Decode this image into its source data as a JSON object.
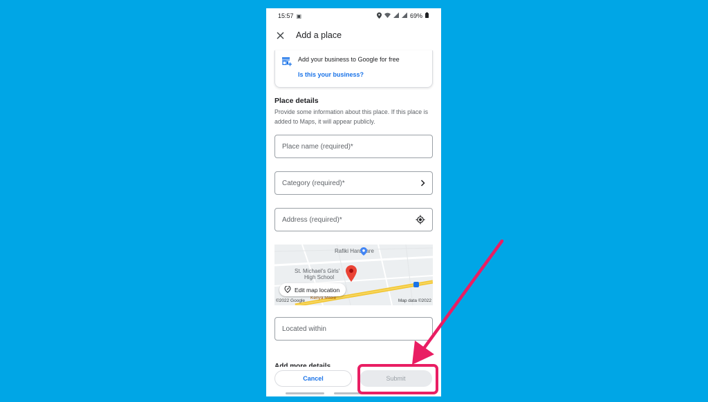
{
  "status_bar": {
    "time": "15:57",
    "battery": "69%",
    "icons": [
      "photo-icon",
      "location-icon",
      "wifi-icon",
      "signal-icon",
      "lte-icon",
      "battery-icon"
    ]
  },
  "app_bar": {
    "title": "Add a place",
    "close_icon": "close-icon"
  },
  "business_card": {
    "icon": "store-add-icon",
    "title": "Add your business to Google for free",
    "link": "Is this your business?"
  },
  "place_details": {
    "title": "Place details",
    "description": "Provide some information about this place. If this place is added to Maps, it will appear publicly."
  },
  "fields": {
    "place_name": {
      "placeholder": "Place name (required)*"
    },
    "category": {
      "placeholder": "Category (required)*",
      "trailing_icon": "chevron-right-icon"
    },
    "address": {
      "placeholder": "Address (required)*",
      "trailing_icon": "my-location-icon"
    },
    "located_within": {
      "placeholder": "Located within"
    }
  },
  "map": {
    "poi_1": "Rafiki Hardware",
    "poi_2_line1": "St. Michael's Girls'",
    "poi_2_line2": "High School",
    "road_label": "Kenya Mileie",
    "edit_button": "Edit map location",
    "copyright": "©2022 Google",
    "map_data": "Map data ©2022"
  },
  "more_details_heading": "Add more details",
  "actions": {
    "cancel": "Cancel",
    "submit": "Submit"
  },
  "colors": {
    "background": "#00a6e6",
    "accent_blue": "#1a73e8",
    "highlight": "#e91e63"
  }
}
